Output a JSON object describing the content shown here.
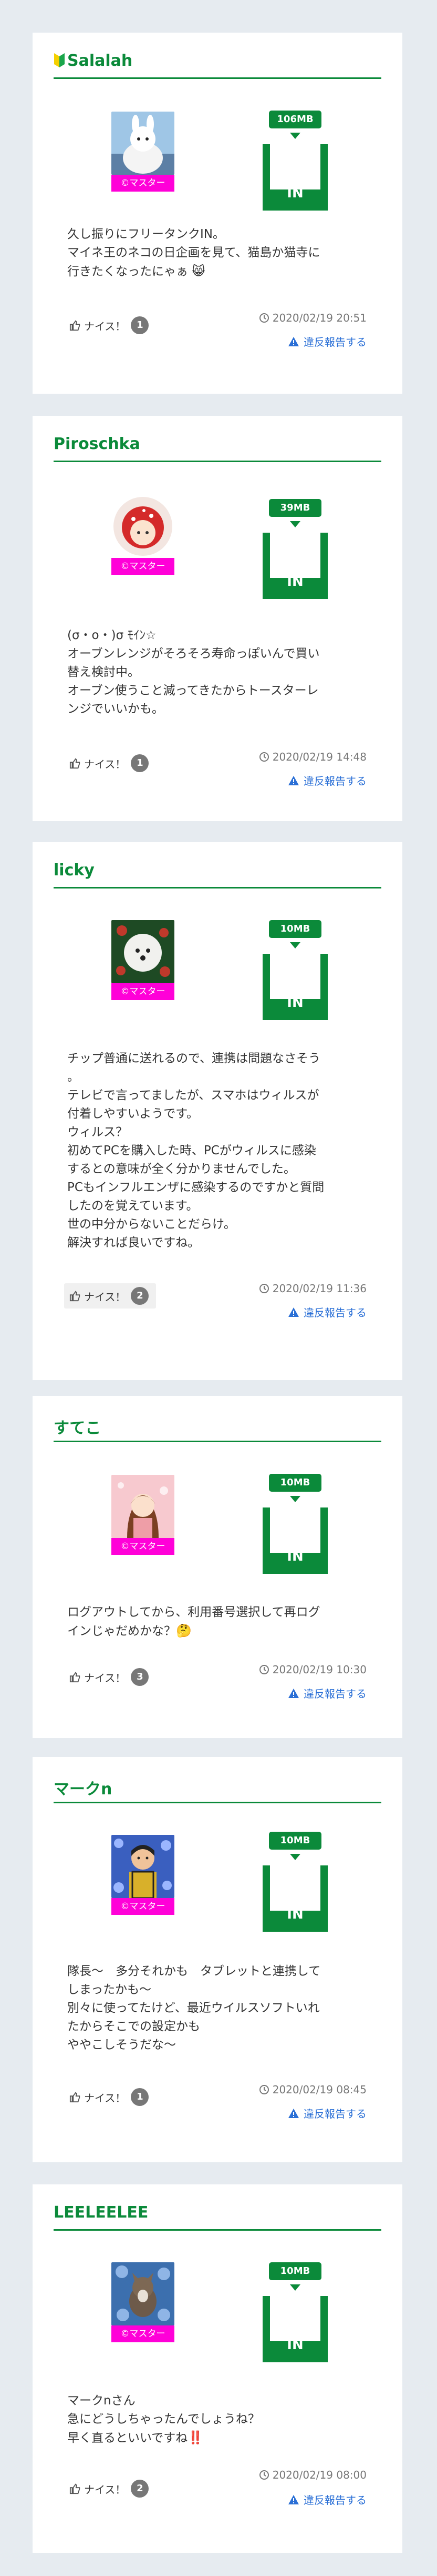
{
  "colors": {
    "accent_green": "#0b8a3a",
    "master_badge": "#ff00d8",
    "link_blue": "#2a6fd6",
    "page_bg": "#e6ebf0"
  },
  "labels": {
    "tank_in": "IN",
    "master": "©マスター",
    "nice": "ナイス！",
    "report": "違反報告する"
  },
  "posts": [
    {
      "username": "Salalah",
      "beginner_icon": "beginner-mark-icon",
      "avatar_icon": "white-rabbit-avatar",
      "mb": "106MB",
      "comment": [
        "久し振りにフリータンクIN。",
        "マイネ王のネコの日企画を見て、猫島か猫寺に",
        "行きたくなったにゃぁ"
      ],
      "comment_emoji": "😸",
      "nice_count": "1",
      "timestamp": "2020/02/19 20:51"
    },
    {
      "username": "Piroschka",
      "avatar_icon": "red-hood-girl-avatar",
      "mb": "39MB",
      "comment": [
        "(σ・o・)σ ﾓｲﾝ☆",
        "オーブンレンジがそろそろ寿命っぽいんで買い",
        "替え検討中。",
        "オーブン使うこと減ってきたからトースターレ",
        "ンジでいいかも。"
      ],
      "nice_count": "1",
      "timestamp": "2020/02/19 14:48"
    },
    {
      "username": "licky",
      "avatar_icon": "dog-wreath-avatar",
      "mb": "10MB",
      "comment": [
        "チップ普通に送れるので、連携は問題なさそう",
        "。",
        "テレビで言ってましたが、スマホはウィルスが",
        "付着しやすいようです。",
        "ウィルス？",
        "初めてPCを購入した時、PCがウィルスに感染",
        "するとの意味が全く分かりませんでした。",
        "PCもインフルエンザに感染するのですかと質問",
        "したのを覚えています。",
        "世の中分からないことだらけ。",
        "解決すれば良いですね。"
      ],
      "nice_count": "2",
      "timestamp": "2020/02/19 11:36"
    },
    {
      "username": "すてこ",
      "avatar_icon": "anime-girl-avatar",
      "mb": "10MB",
      "comment": [
        "ログアウトしてから、利用番号選択して再ログ",
        "インじゃだめかな？"
      ],
      "comment_emoji": "🤔",
      "nice_count": "3",
      "timestamp": "2020/02/19 10:30"
    },
    {
      "username": "マークn",
      "avatar_icon": "man-flowers-avatar",
      "mb": "10MB",
      "comment": [
        "隊長〜　多分それかも　タブレットと連携して",
        "しまったかも〜",
        "別々に使ってたけど、最近ウイルスソフトいれ",
        "たからそこでの設定かも",
        "ややこしそうだな〜"
      ],
      "nice_count": "1",
      "timestamp": "2020/02/19 08:45"
    },
    {
      "username": "LEELEELEE",
      "avatar_icon": "cat-flowers-avatar",
      "mb": "10MB",
      "comment": [
        "マークnさん",
        "急にどうしちゃったんでしょうね？",
        "早く直るといいですね"
      ],
      "comment_emoji": "‼️",
      "nice_count": "2",
      "timestamp": "2020/02/19 08:00"
    }
  ]
}
